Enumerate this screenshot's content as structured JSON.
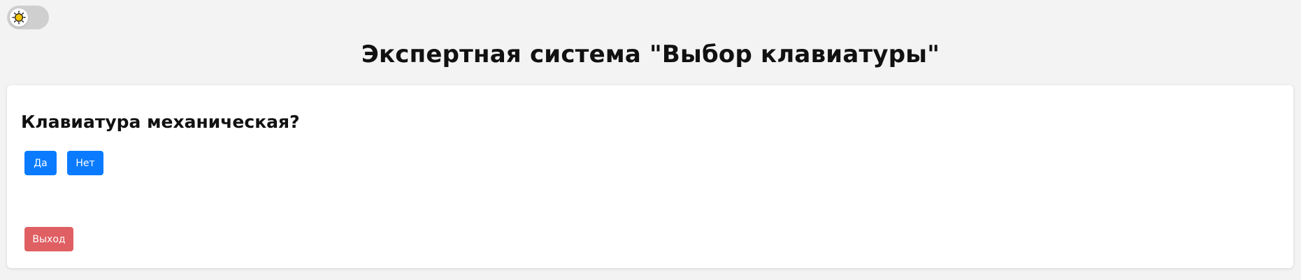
{
  "theme_toggle": {
    "icon": "sun-icon",
    "state": "light"
  },
  "header": {
    "title": "Экспертная система \"Выбор клавиатуры\""
  },
  "question_card": {
    "question": "Клавиатура механическая?",
    "yes_label": "Да",
    "no_label": "Нет",
    "exit_label": "Выход"
  },
  "colors": {
    "background": "#f3f3f3",
    "card": "#ffffff",
    "primary_button": "#0a7bff",
    "exit_button": "#df5f63",
    "toggle_track": "#cfcfcf",
    "sun": "#f2c200"
  }
}
